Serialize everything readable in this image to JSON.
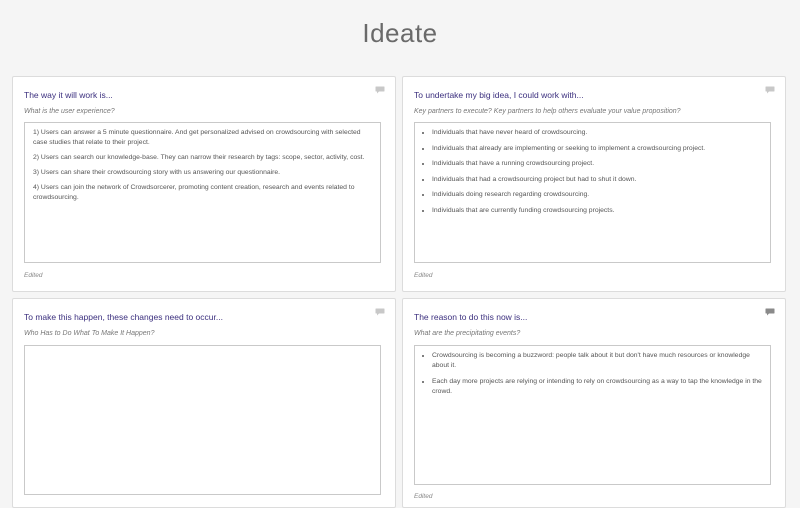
{
  "page": {
    "title": "Ideate"
  },
  "cards": [
    {
      "title": "The way it will work is...",
      "subtitle": "What is the user experience?",
      "paragraphs": [
        "1) Users can answer a 5 minute questionnaire. And get personalized advised on crowdsourcing with selected case studies that relate to their project.",
        "2) Users can search our knowledge-base. They can narrow their research by tags: scope, sector, activity, cost.",
        "3) Users can share their crowdsourcing story with us answering our questionnaire.",
        "4) Users can join the network of Crowdsorcerer, promoting content creation, research and events related to crowdsourcing."
      ],
      "status": "Edited",
      "comment_icon": "comment-icon"
    },
    {
      "title": "To undertake my big idea, I could work with...",
      "subtitle": "Key partners to execute? Key partners to help others evaluate your value proposition?",
      "bullets": [
        "Individuals that have never heard of crowdsourcing.",
        "Individuals that already are implementing or seeking to implement a crowdsourcing project.",
        "Individuals that have a running crowdsourcing project.",
        "Individuals that had a crowdsourcing project but had to shut it down.",
        "Individuals doing research regarding crowdsourcing.",
        "Individuals that are currently funding crowdsourcing projects."
      ],
      "status": "Edited",
      "comment_icon": "comment-icon"
    },
    {
      "title": "To make this happen, these changes need to occur...",
      "subtitle": "Who Has to Do What To Make It Happen?",
      "bullets": [],
      "comment_icon": "comment-icon"
    },
    {
      "title": "The reason to do this now is...",
      "subtitle": "What are the precipitating events?",
      "bullets": [
        "Crowdsourcing is becoming a buzzword: people talk about it but don't have much resources or knowledge about it.",
        "Each day more projects are relying or intending to rely on crowdsourcing as a way to tap the knowledge in the crowd."
      ],
      "status": "Edited",
      "comment_icon": "comment-icon-filled"
    }
  ],
  "colors": {
    "title": "#3b2f7e",
    "background": "#f5f5f5",
    "comment_icon": "#c8c8c8",
    "comment_icon_filled": "#8a8a8a"
  }
}
